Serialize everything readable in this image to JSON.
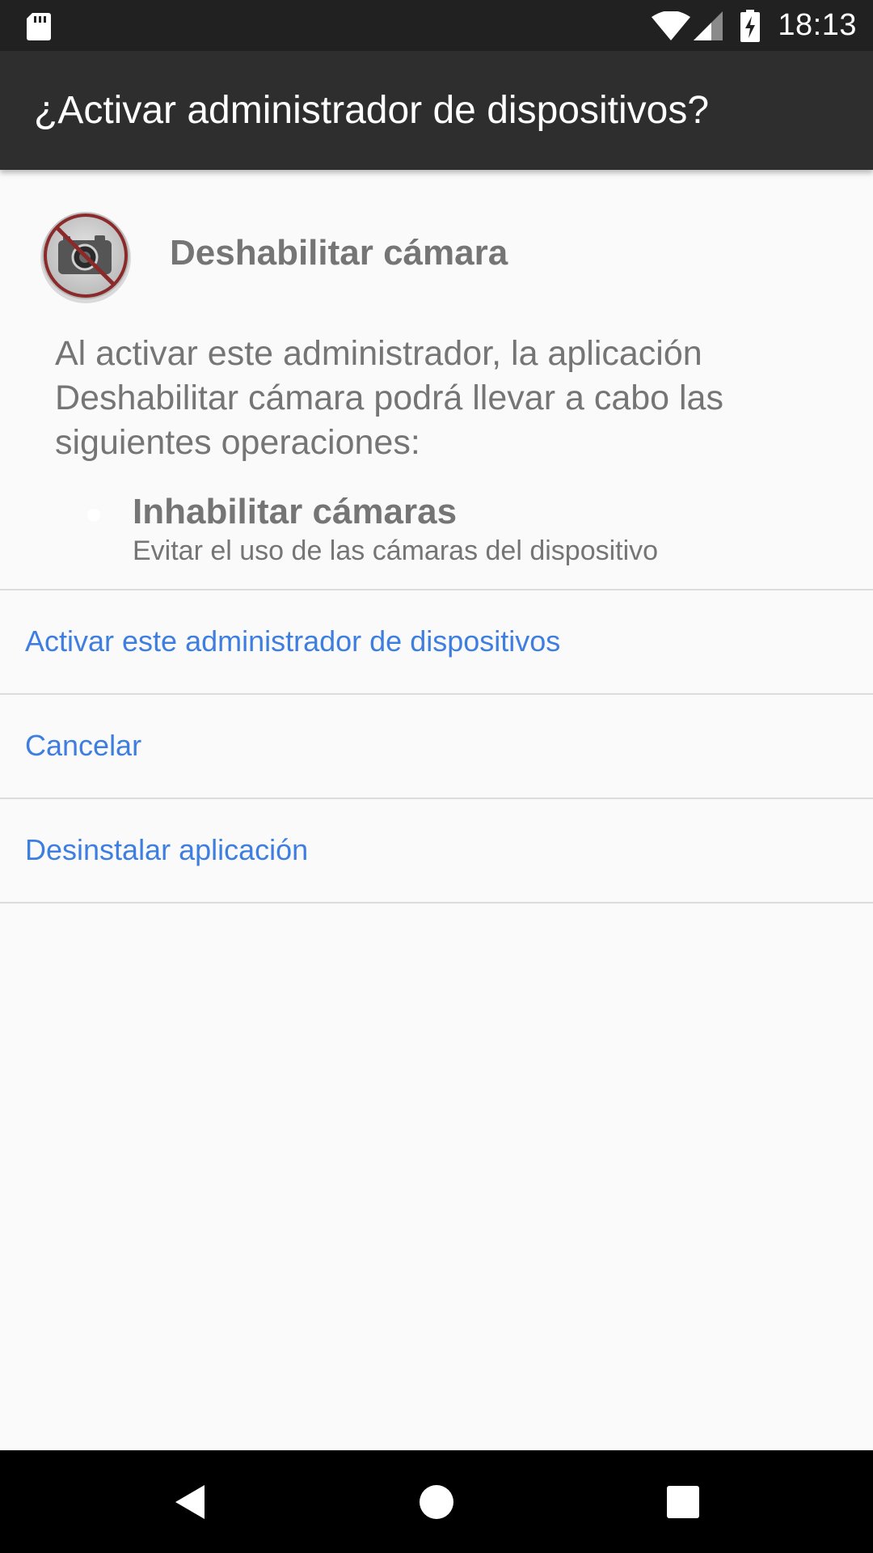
{
  "status_bar": {
    "time": "18:13",
    "icons": [
      "sd-card-icon",
      "wifi-icon",
      "signal-icon",
      "battery-charging-icon"
    ]
  },
  "app_bar": {
    "title": "¿Activar administrador de dispositivos?"
  },
  "admin": {
    "icon": "camera-disabled-icon",
    "app_name": "Deshabilitar cámara",
    "description": "Al activar este administrador, la aplicación Deshabilitar cámara podrá llevar a cabo las siguientes operaciones:",
    "policies": [
      {
        "title": "Inhabilitar cámaras",
        "description": "Evitar el uso de las cámaras del dispositivo"
      }
    ]
  },
  "actions": {
    "activate": "Activar este administrador de dispositivos",
    "cancel": "Cancelar",
    "uninstall": "Desinstalar aplicación"
  },
  "colors": {
    "status_bar": "#212121",
    "app_bar": "#2e2e2e",
    "background": "#fafafa",
    "accent": "#3e7ee0",
    "secondary_text": "#757575"
  },
  "nav_bar": {
    "icons": [
      "back-icon",
      "home-icon",
      "recents-icon"
    ]
  }
}
